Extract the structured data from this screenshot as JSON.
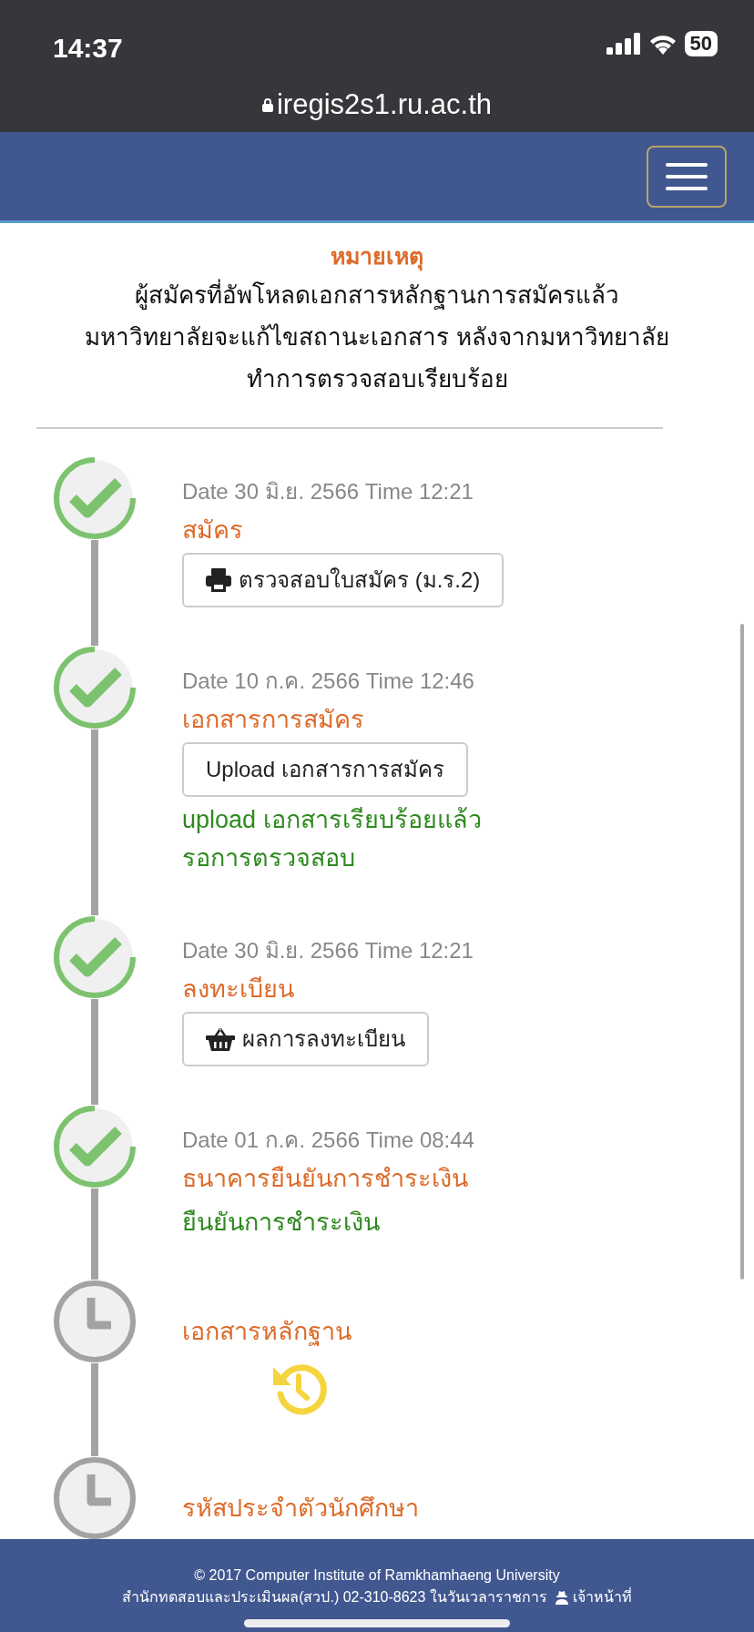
{
  "status_bar": {
    "time": "14:37",
    "battery": "50"
  },
  "browser": {
    "url": "iregis2s1.ru.ac.th"
  },
  "notice": {
    "title": "หมายเหตุ",
    "lines": [
      "ผู้สมัครที่อัพโหลดเอกสารหลักฐานการสมัครแล้ว",
      "มหาวิทยาลัยจะแก้ไขสถานะเอกสาร หลังจากมหาวิทยาลัย",
      "ทำการตรวจสอบเรียบร้อย"
    ]
  },
  "steps": [
    {
      "kind": "done",
      "date": "Date 30 มิ.ย. 2566 Time 12:21",
      "title": "สมัคร",
      "button": {
        "kind": "print",
        "label": "ตรวจสอบใบสมัคร (ม.ร.2)"
      }
    },
    {
      "kind": "done",
      "date": "Date 10 ก.ค. 2566 Time 12:46",
      "title": "เอกสารการสมัคร",
      "button": {
        "kind": "plain",
        "label": "Upload เอกสารการสมัคร"
      },
      "note": [
        "upload เอกสารเรียบร้อยแล้ว",
        "รอการตรวจสอบ"
      ]
    },
    {
      "kind": "done",
      "date": "Date 30 มิ.ย. 2566 Time 12:21",
      "title": "ลงทะเบียน",
      "button": {
        "kind": "result",
        "label": "ผลการลงทะเบียน"
      }
    },
    {
      "kind": "done",
      "date": "Date 01 ก.ค. 2566 Time 08:44",
      "title": "ธนาคารยืนยันการชำระเงิน",
      "note": [
        "ยืนยันการชำระเงิน"
      ]
    },
    {
      "kind": "waiting",
      "title": "เอกสารหลักฐาน"
    },
    {
      "kind": "pending",
      "title": "รหัสประจำตัวนักศึกษา"
    }
  ],
  "footer": {
    "copyright": "© 2017 Computer Institute of Ramkhamhaeng University",
    "contact": "สำนักทดสอบและประเมินผล(สวป.) 02-310-8623 ในวันเวลาราชการ",
    "staff_link": "เจ้าหน้าที่"
  }
}
